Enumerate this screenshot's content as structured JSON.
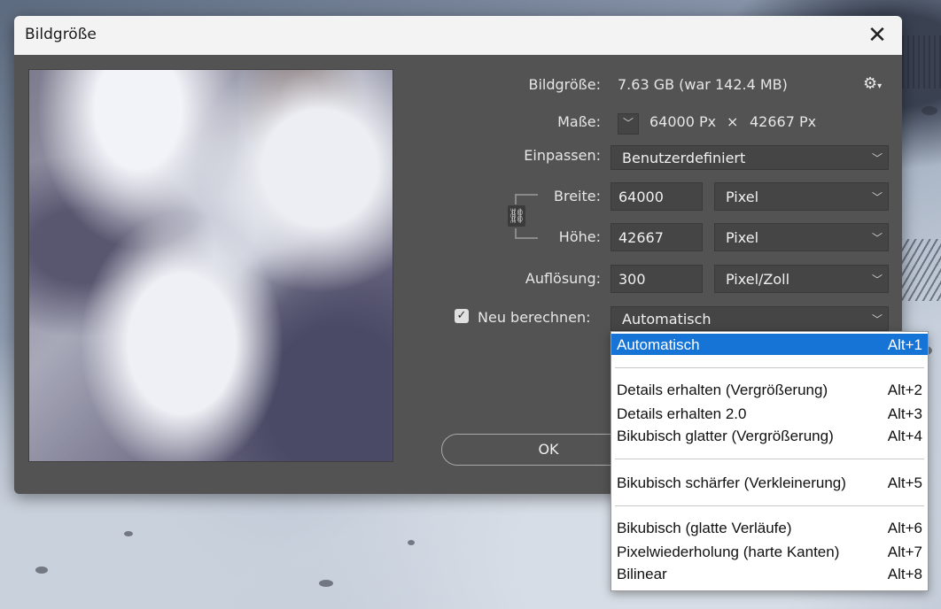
{
  "dialog": {
    "title": "Bildgröße",
    "close": "✕"
  },
  "info": {
    "size_label": "Bildgröße:",
    "size_value": "7.63 GB (war 142.4 MB)",
    "dims_label": "Maße:",
    "dims_width": "64000 Px",
    "dims_times": "×",
    "dims_height": "42667 Px"
  },
  "fit": {
    "label": "Einpassen:",
    "value": "Benutzerdefiniert"
  },
  "width": {
    "label": "Breite:",
    "value": "64000",
    "unit": "Pixel"
  },
  "height": {
    "label": "Höhe:",
    "value": "42667",
    "unit": "Pixel"
  },
  "resolution": {
    "label": "Auflösung:",
    "value": "300",
    "unit": "Pixel/Zoll"
  },
  "resample": {
    "label": "Neu berechnen:",
    "checked": true,
    "value": "Automatisch"
  },
  "buttons": {
    "ok": "OK"
  },
  "menu": {
    "items": [
      {
        "label": "Automatisch",
        "shortcut": "Alt+1"
      },
      {
        "label": "Details erhalten (Vergrößerung)",
        "shortcut": "Alt+2"
      },
      {
        "label": "Details erhalten 2.0",
        "shortcut": "Alt+3"
      },
      {
        "label": "Bikubisch glatter (Vergrößerung)",
        "shortcut": "Alt+4"
      },
      {
        "label": "Bikubisch schärfer (Verkleinerung)",
        "shortcut": "Alt+5"
      },
      {
        "label": "Bikubisch (glatte Verläufe)",
        "shortcut": "Alt+6"
      },
      {
        "label": "Pixelwiederholung (harte Kanten)",
        "shortcut": "Alt+7"
      },
      {
        "label": "Bilinear",
        "shortcut": "Alt+8"
      }
    ]
  },
  "colors": {
    "dialog_bg": "#535353",
    "field_bg": "#454545",
    "highlight": "#1574d6"
  },
  "icons": {
    "settings": "gear-icon",
    "link": "link-icon",
    "chevron": "chevron-down-icon"
  }
}
